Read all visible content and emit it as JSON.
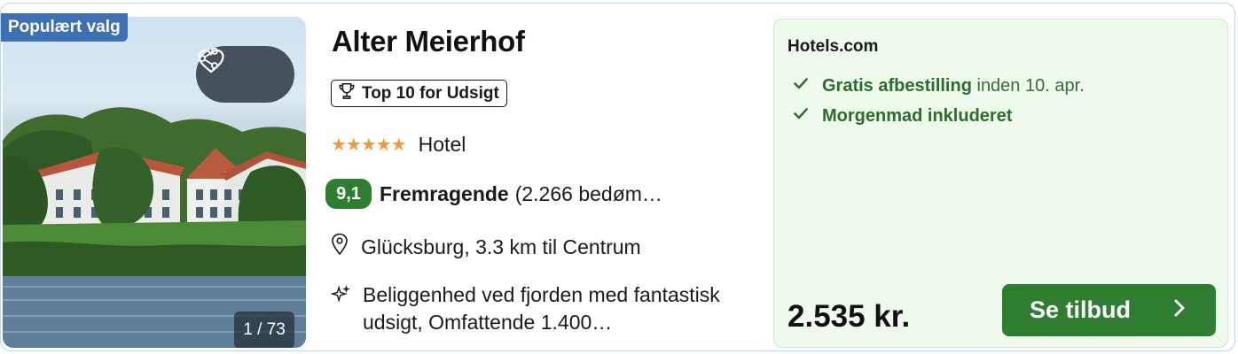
{
  "hotel": {
    "badge": "Populært valg",
    "photo_counter": "1 / 73",
    "name": "Alter Meierhof",
    "award": "Top 10 for Udsigt",
    "stars": "★★★★★",
    "star_count": 5,
    "type": "Hotel",
    "score": "9,1",
    "rating_word": "Fremragende",
    "reviews": "(2.266 bedøm…",
    "location": "Glücksburg, 3.3 km til Centrum",
    "description": "Beliggenhed ved fjorden med fantastisk udsigt, Omfattende 1.400…"
  },
  "offer": {
    "provider": "Hotels.com",
    "perks": [
      {
        "bold": "Gratis afbestilling",
        "rest": " inden 10. apr."
      },
      {
        "bold": "Morgenmad inkluderet",
        "rest": ""
      }
    ],
    "price": "2.535 kr.",
    "cta_label": "Se tilbud"
  },
  "icons": {
    "share": "share-icon",
    "heart": "heart-icon",
    "trophy": "trophy-icon",
    "pin": "location-pin-icon",
    "sparkle": "sparkle-icon",
    "check": "check-icon",
    "chevron": "chevron-right-icon"
  },
  "colors": {
    "badge_blue": "#3c6fb4",
    "star_orange": "#ef9a3c",
    "score_green": "#2e7d31",
    "offer_bg": "#eefaec"
  }
}
